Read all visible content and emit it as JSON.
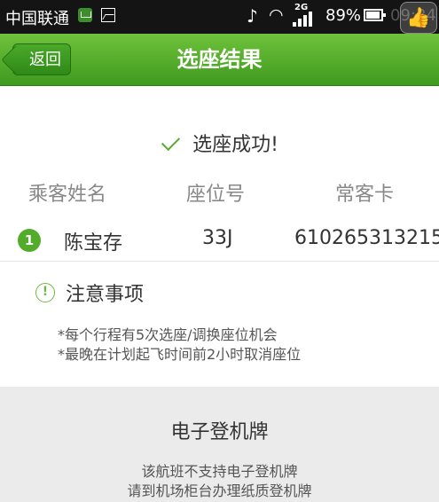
{
  "status_bar": {
    "carrier": "中国联通",
    "battery_percent": "89%",
    "time": "09:34"
  },
  "header": {
    "back_label": "返回",
    "title": "选座结果"
  },
  "result": {
    "message": "选座成功!"
  },
  "table": {
    "columns": [
      "乘客姓名",
      "座位号",
      "常客卡"
    ],
    "rows": [
      {
        "index": "1",
        "name": "陈宝存",
        "seat": "33J",
        "card": "610265313215"
      }
    ]
  },
  "notice": {
    "title": "注意事项",
    "lines": [
      "*每个行程有5次选座/调换座位机会",
      "*最晚在计划起飞时间前2小时取消座位"
    ]
  },
  "boarding_pass": {
    "title": "电子登机牌",
    "lines": [
      "该航班不支持电子登机牌",
      "请到机场柜台办理纸质登机牌"
    ]
  },
  "colors": {
    "header_green": "#4fa827",
    "accent_green": "#52ac2a",
    "section_gray": "#ebebeb"
  }
}
